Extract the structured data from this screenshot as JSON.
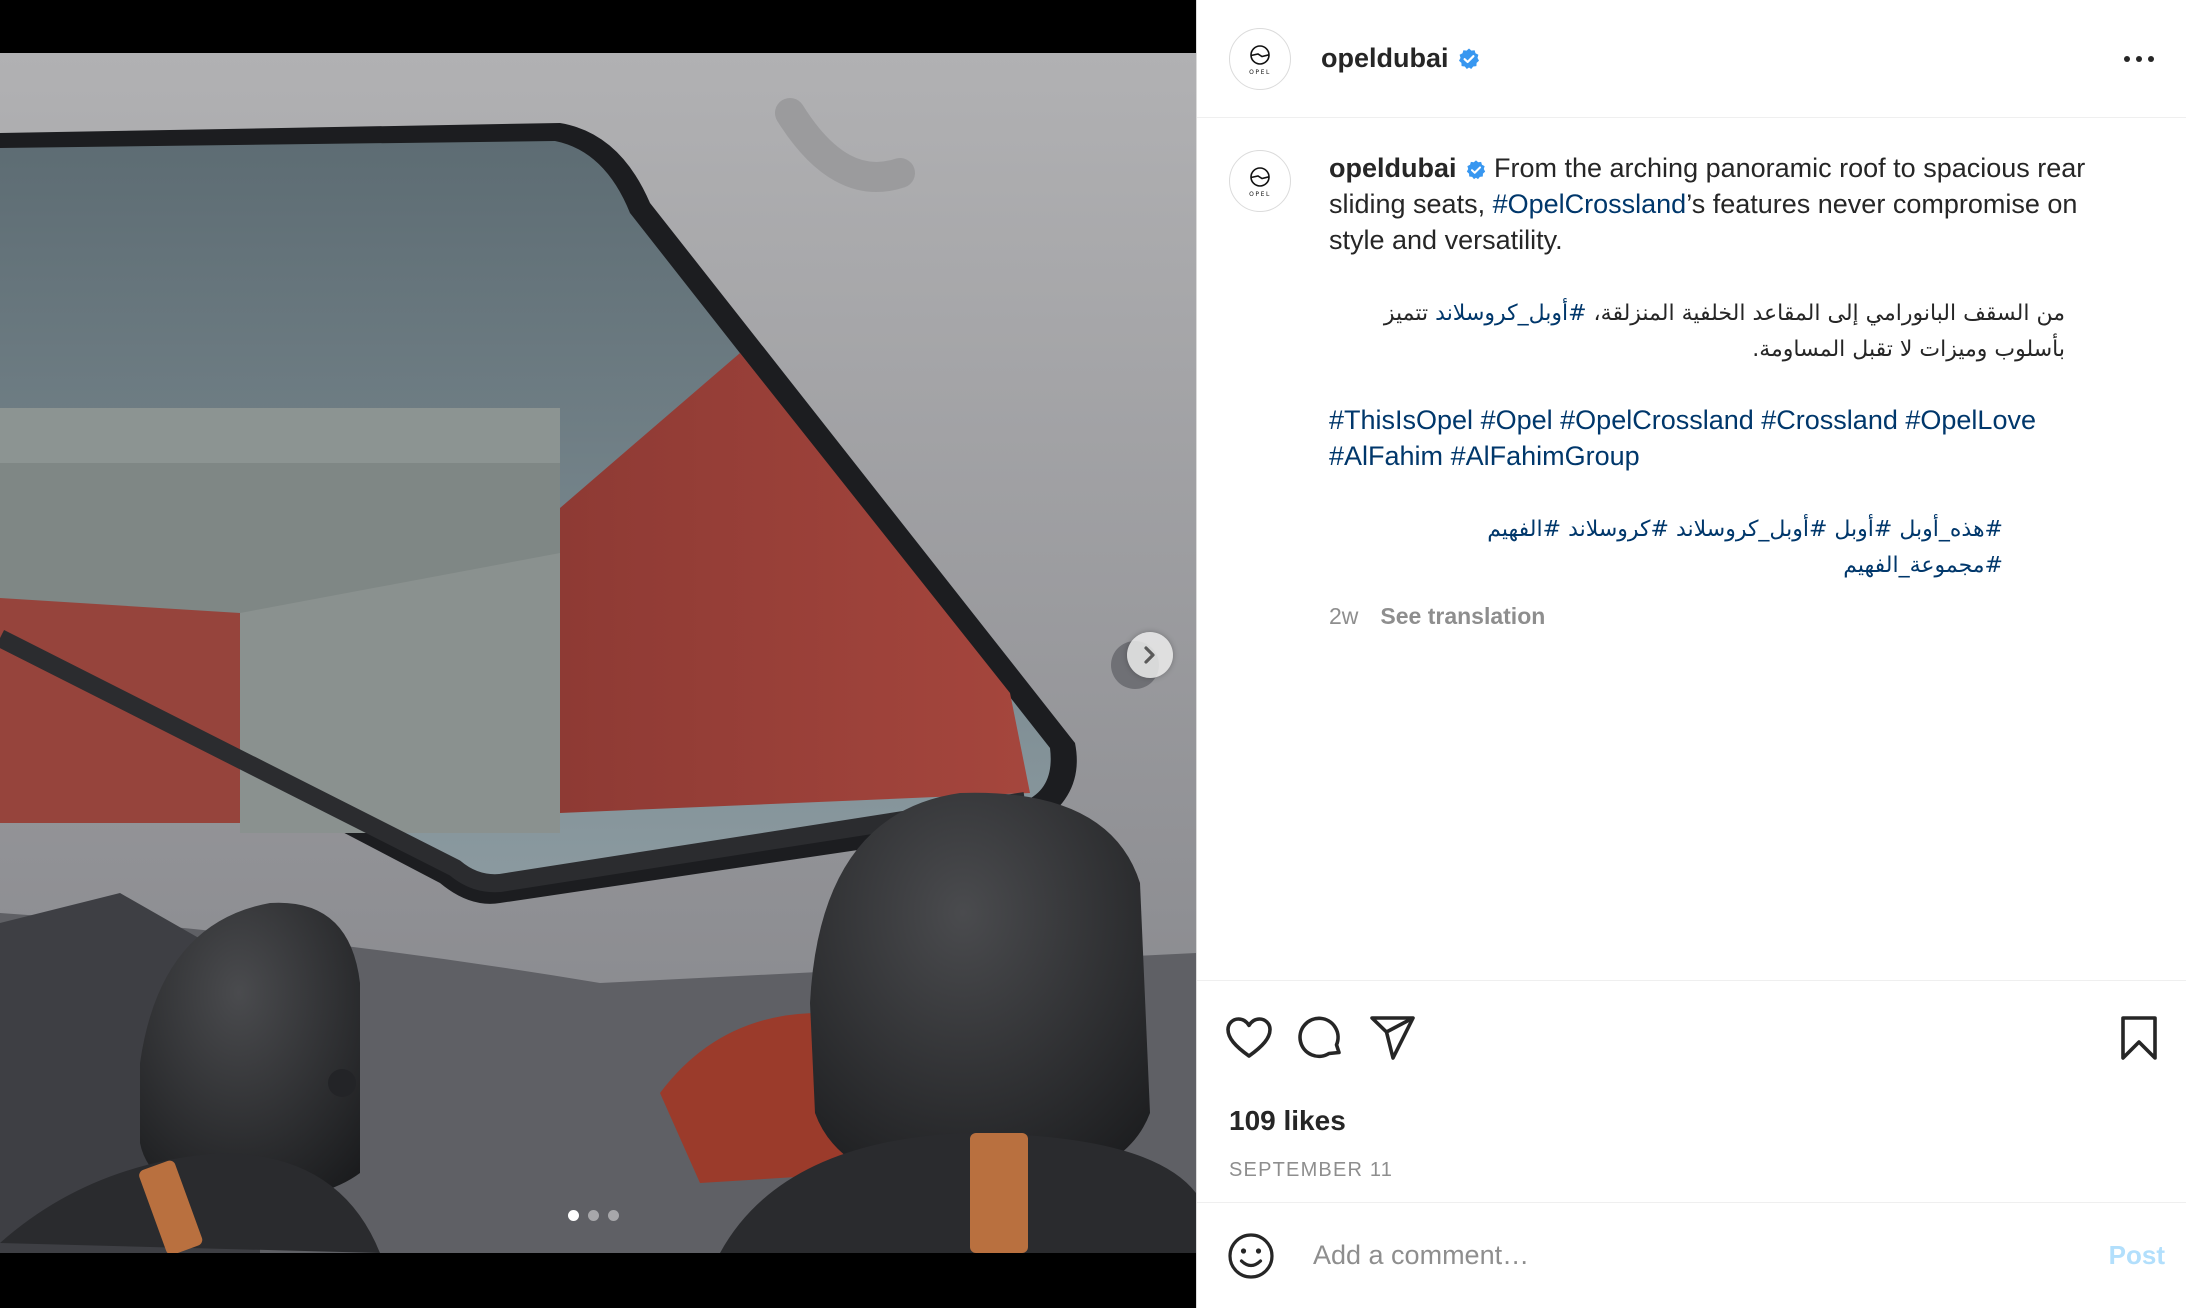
{
  "post": {
    "username": "opeldubai",
    "verified": true,
    "avatar_brand": "OPEL",
    "image_alt": "Opel Crossland interior with panoramic roof",
    "carousel": {
      "current": 1,
      "total": 3
    }
  },
  "caption": {
    "username": "opeldubai",
    "text_before": " From the arching panoramic roof to spacious rear sliding seats, ",
    "tag_crossland": "#OpelCrossland",
    "text_after": "’s features never compromise on style and versatility.",
    "arabic_before": "من السقف البانورامي إلى المقاعد الخلفية المنزلقة، ",
    "arabic_tag": "#أوبل_كروسلاند",
    "arabic_after": " تتميز بأسلوب وميزات لا تقبل المساومة.",
    "hashtags": [
      "#ThisIsOpel",
      "#Opel",
      "#OpelCrossland",
      "#Crossland",
      "#OpelLove",
      "#AlFahim",
      "#AlFahimGroup"
    ],
    "arabic_hashtags": [
      "#هذه_أوبل",
      "#أوبل",
      "#أوبل_كروسلاند",
      "#كروسلاند",
      "#الفهيم",
      "#مجموعة_الفهيم"
    ],
    "time": "2w",
    "see_translation": "See translation"
  },
  "actions": {
    "like_icon": "heart-icon",
    "comment_icon": "comment-bubble-icon",
    "share_icon": "paper-plane-icon",
    "save_icon": "bookmark-icon"
  },
  "likes_text": "109 likes",
  "date_text": "SEPTEMBER 11",
  "comment": {
    "placeholder": "Add a comment…",
    "post_label": "Post",
    "emoji_icon": "smiley-icon"
  },
  "colors": {
    "hashtag": "#00376b",
    "verified": "#3897f0",
    "post_button_disabled": "#b2dffc",
    "secondary_text": "#8e8e8e"
  }
}
